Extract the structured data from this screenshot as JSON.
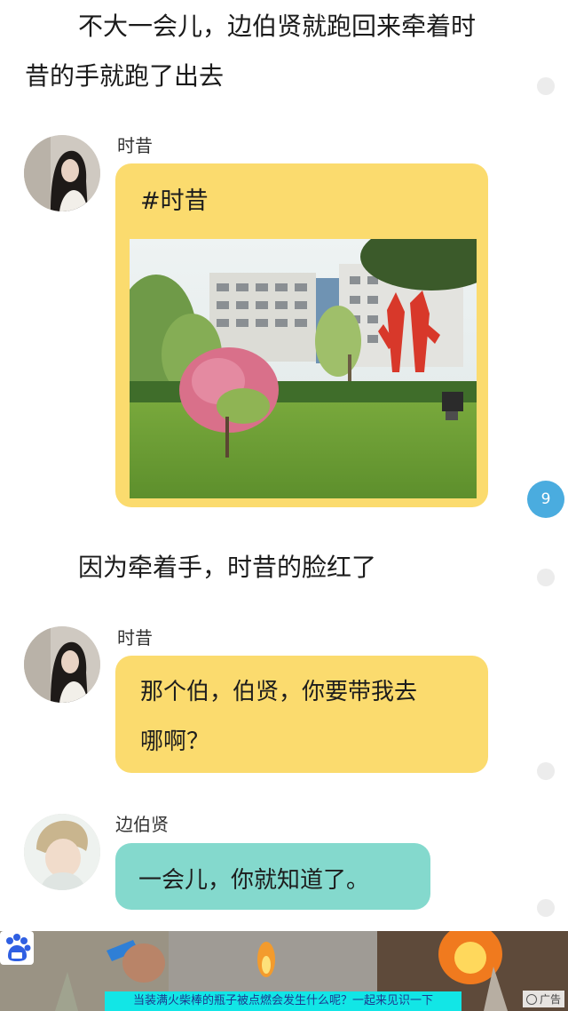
{
  "narration": {
    "first_line1": "不大一会儿，边伯贤就跑回来牵着时",
    "first_line2": "昔的手就跑了出去",
    "second": "因为牵着手，时昔的脸红了"
  },
  "messages": [
    {
      "speaker": "时昔",
      "hashtag": "#时昔"
    },
    {
      "speaker": "时昔",
      "line1": "那个伯，伯贤，你要带我去",
      "line2": "哪啊？"
    },
    {
      "speaker": "边伯贤",
      "text": "一会儿，你就知道了。"
    }
  ],
  "comment_count": "9",
  "ad": {
    "caption": "当装满火柴棒的瓶子被点燃会发生什么呢？一起来见识一下",
    "badge_label": "广告"
  },
  "colors": {
    "bubble_yellow": "#fbdb6e",
    "bubble_teal": "#84d9cd",
    "badge_blue": "#4aacdf",
    "ad_caption_bg": "#12e6e6"
  }
}
